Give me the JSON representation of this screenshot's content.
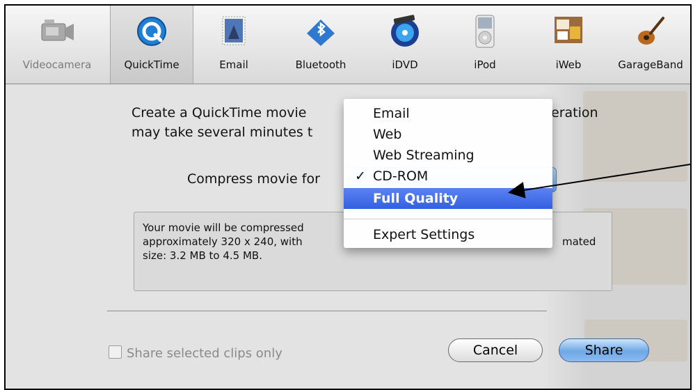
{
  "toolbar": {
    "items": [
      {
        "label": "Videocamera",
        "icon": "videocamera-icon",
        "disabled": true
      },
      {
        "label": "QuickTime",
        "icon": "quicktime-icon",
        "selected": true
      },
      {
        "label": "Email",
        "icon": "email-stamp-icon"
      },
      {
        "label": "Bluetooth",
        "icon": "bluetooth-icon"
      },
      {
        "label": "iDVD",
        "icon": "idvd-icon"
      },
      {
        "label": "iPod",
        "icon": "ipod-icon"
      },
      {
        "label": "iWeb",
        "icon": "iweb-icon"
      },
      {
        "label": "GarageBand",
        "icon": "guitar-icon"
      }
    ]
  },
  "description": {
    "line1_a": "Create a QuickTime movie",
    "line1_b": "eration",
    "line2": "may take several minutes t"
  },
  "compress": {
    "label": "Compress movie for"
  },
  "menu": {
    "items": [
      "Email",
      "Web",
      "Web Streaming",
      "CD-ROM",
      "Full Quality",
      "Expert Settings"
    ],
    "checked": "CD-ROM",
    "highlighted": "Full Quality",
    "check_mark": "✓"
  },
  "info": {
    "line1": "Your movie will be compressed",
    "line2_a": "approximately 320 x 240, with",
    "line2_b": "mated",
    "line3": "size: 3.2 MB to 4.5 MB."
  },
  "checkbox": {
    "label": "Share selected clips only",
    "checked": false
  },
  "buttons": {
    "cancel": "Cancel",
    "share": "Share"
  },
  "colors": {
    "highlight": "#3f6ae6",
    "share_button": "#6ea8e6"
  }
}
